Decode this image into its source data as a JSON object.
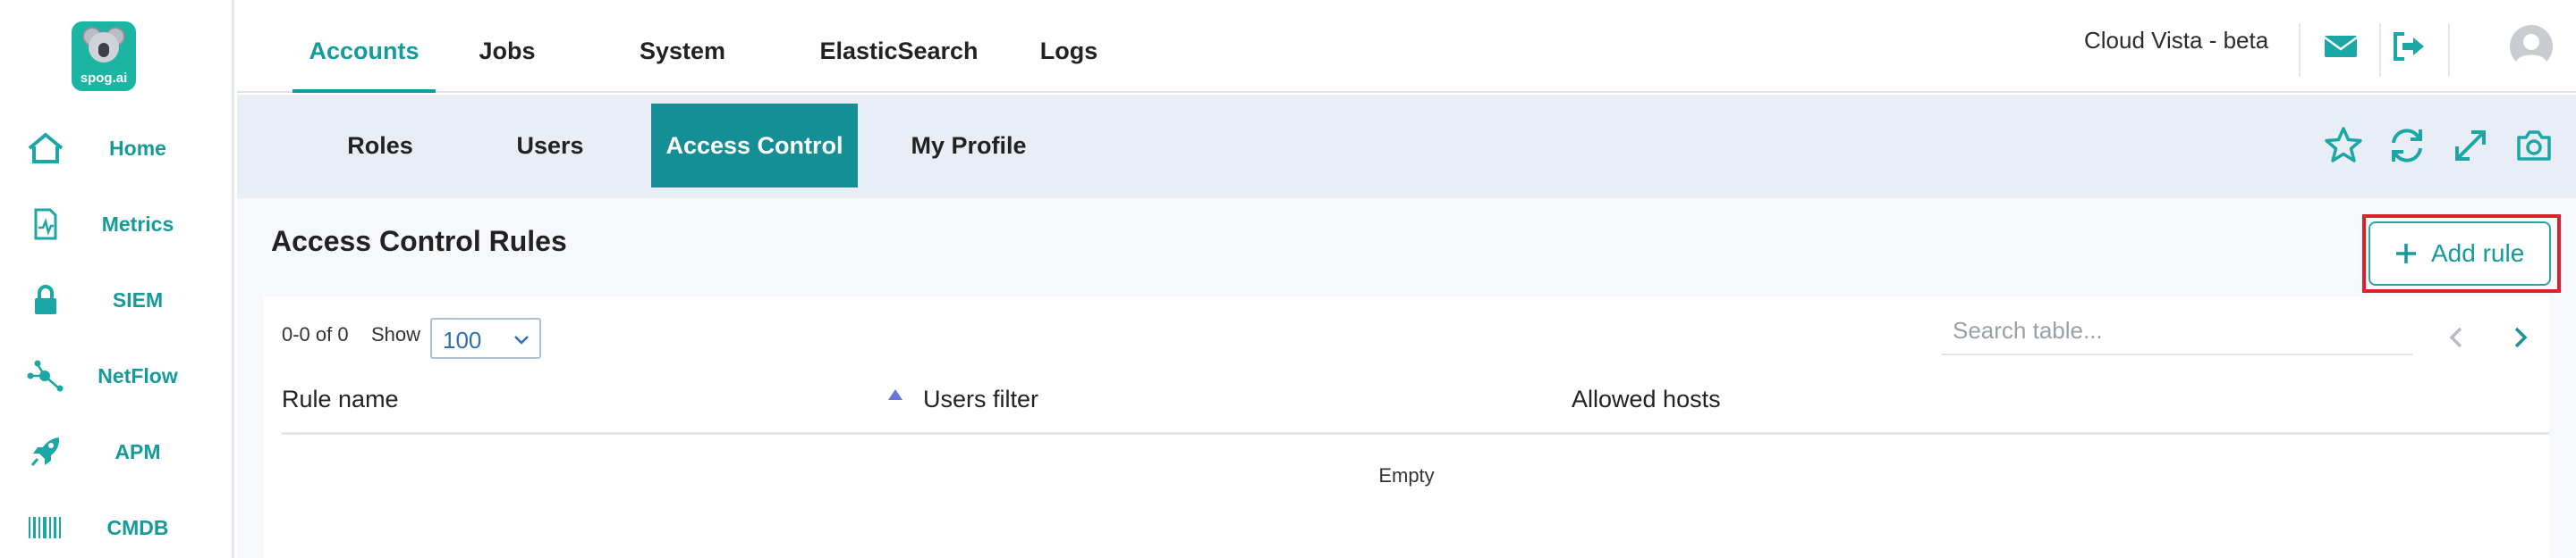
{
  "logo": {
    "text": "spog.ai"
  },
  "sidebar": {
    "items": [
      {
        "label": "Home",
        "icon": "home-icon"
      },
      {
        "label": "Metrics",
        "icon": "metrics-icon"
      },
      {
        "label": "SIEM",
        "icon": "lock-icon"
      },
      {
        "label": "NetFlow",
        "icon": "network-icon"
      },
      {
        "label": "APM",
        "icon": "rocket-icon"
      },
      {
        "label": "CMDB",
        "icon": "barcode-icon"
      }
    ]
  },
  "topnav": {
    "tabs": [
      "Accounts",
      "Jobs",
      "System",
      "ElasticSearch",
      "Logs"
    ],
    "active": "Accounts",
    "brand": "Cloud Vista - beta",
    "icons": [
      "mail-icon",
      "logout-icon",
      "user-avatar-icon"
    ]
  },
  "subnav": {
    "tabs": [
      "Roles",
      "Users",
      "Access Control",
      "My Profile"
    ],
    "active": "Access Control",
    "icons": [
      "star-icon",
      "refresh-icon",
      "expand-icon",
      "camera-icon"
    ]
  },
  "page": {
    "title": "Access Control Rules",
    "add_button": "Add rule"
  },
  "table": {
    "count_text": "0-0 of 0",
    "show_label": "Show",
    "page_size": "100",
    "search_placeholder": "Search table...",
    "columns": [
      "Rule name",
      "Users filter",
      "Allowed hosts"
    ],
    "sorted_column": "Users filter",
    "sort_direction": "ascending",
    "rows": [],
    "empty_text": "Empty"
  },
  "colors": {
    "accent": "#169a9c",
    "active_tab_bg": "#168e95",
    "subbar_bg": "#e9eef6",
    "highlight_border": "#d8232a"
  }
}
